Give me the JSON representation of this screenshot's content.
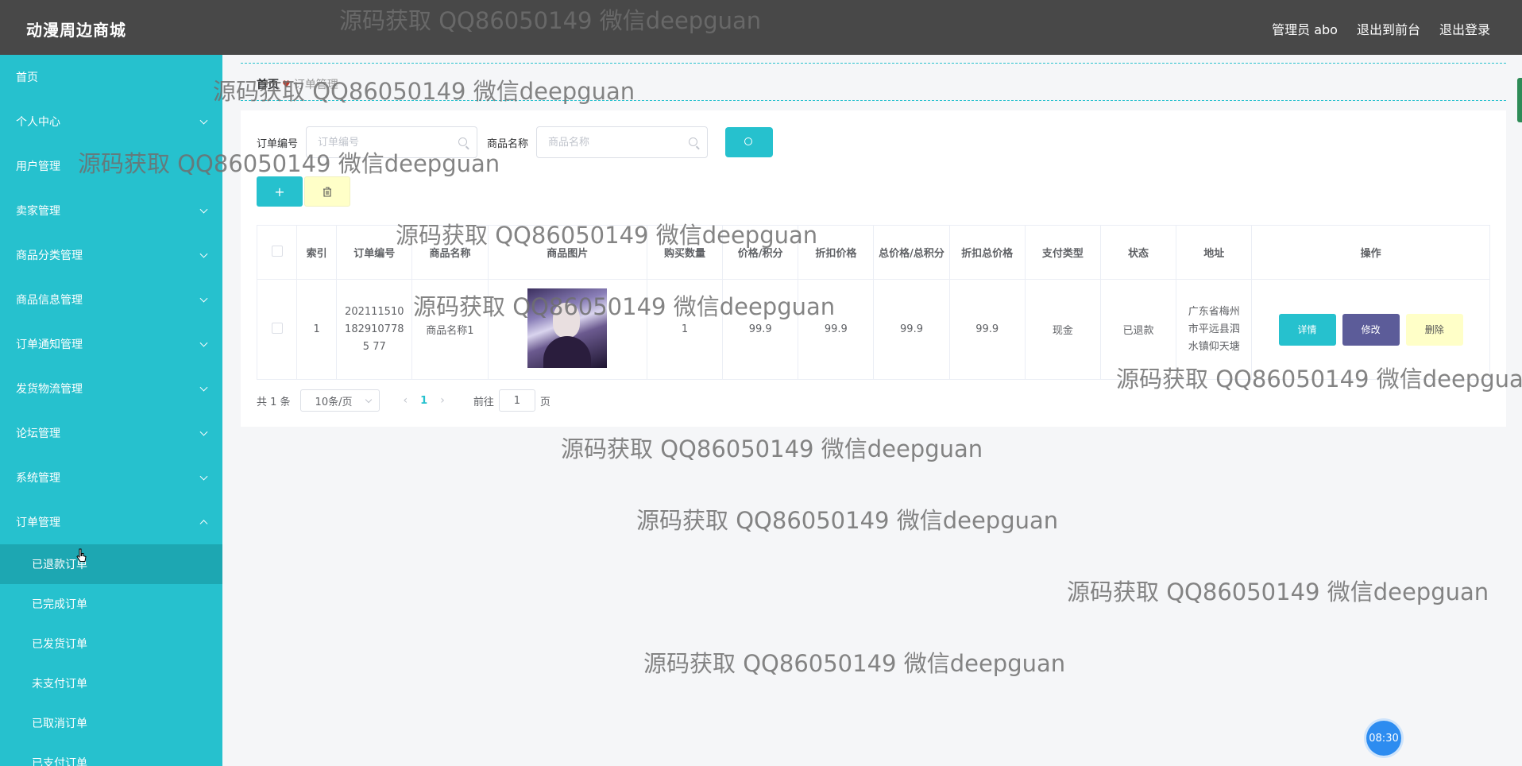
{
  "app": {
    "brand": "动漫周边商城"
  },
  "header": {
    "admin": "管理员 abo",
    "to_front": "退出到前台",
    "logout": "退出登录"
  },
  "sidebar": {
    "items": [
      {
        "label": "首页",
        "expandable": false
      },
      {
        "label": "个人中心",
        "expandable": true
      },
      {
        "label": "用户管理",
        "expandable": false
      },
      {
        "label": "卖家管理",
        "expandable": true
      },
      {
        "label": "商品分类管理",
        "expandable": true
      },
      {
        "label": "商品信息管理",
        "expandable": true
      },
      {
        "label": "订单通知管理",
        "expandable": true
      },
      {
        "label": "发货物流管理",
        "expandable": true
      },
      {
        "label": "论坛管理",
        "expandable": true
      },
      {
        "label": "系统管理",
        "expandable": true
      },
      {
        "label": "订单管理",
        "expandable": true,
        "expanded": true
      }
    ],
    "sub_items": [
      {
        "label": "已退款订单",
        "active": true
      },
      {
        "label": "已完成订单"
      },
      {
        "label": "已发货订单"
      },
      {
        "label": "未支付订单"
      },
      {
        "label": "已取消订单"
      },
      {
        "label": "已支付订单"
      }
    ]
  },
  "breadcrumb": {
    "home": "首页",
    "sep": "♥",
    "current": "订单管理"
  },
  "search": {
    "order_no_label": "订单编号",
    "order_no_placeholder": "订单编号",
    "product_label": "商品名称",
    "product_placeholder": "商品名称"
  },
  "actions": {
    "add": "+",
    "delete_icon": "trash-icon"
  },
  "table": {
    "headers": [
      "索引",
      "订单编号",
      "商品名称",
      "商品图片",
      "购买数量",
      "价格/积分",
      "折扣价格",
      "总价格/总积分",
      "折扣总价格",
      "支付类型",
      "状态",
      "地址",
      "操作"
    ],
    "rows": [
      {
        "index": "1",
        "order_no": "2021115101829107785 77",
        "product_name": "商品名称1",
        "quantity": "1",
        "price": "99.9",
        "discount_price": "99.9",
        "total": "99.9",
        "discount_total": "99.9",
        "pay_type": "现金",
        "status": "已退款",
        "address": "广东省梅州市平远县泗水镇仰天塘",
        "op_detail": "详情",
        "op_edit": "修改",
        "op_delete": "删除"
      }
    ]
  },
  "pager": {
    "total": "共 1 条",
    "size": "10条/页",
    "current": "1",
    "goto": "前往",
    "goto_value": "1",
    "page_unit": "页"
  },
  "watermark": "源码获取 QQ86050149 微信deepguan",
  "clock": "08:30",
  "colors": {
    "accent": "#26c1ce",
    "topbar": "#484848",
    "edit": "#5c5c99",
    "delete": "#ffffc8"
  }
}
